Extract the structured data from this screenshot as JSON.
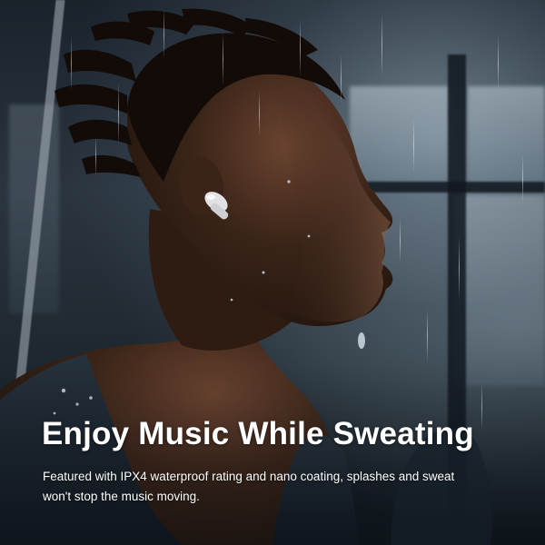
{
  "banner": {
    "headline": "Enjoy Music While Sweating",
    "subcopy": "Featured with IPX4 waterproof rating and nano coating, splashes and sweat won't stop the music moving."
  },
  "palette": {
    "text": "#ffffff",
    "background": "#1a232c",
    "skin": "#3a2418",
    "earbud": "#d8d8dc",
    "tank_top": "#1c2630"
  }
}
